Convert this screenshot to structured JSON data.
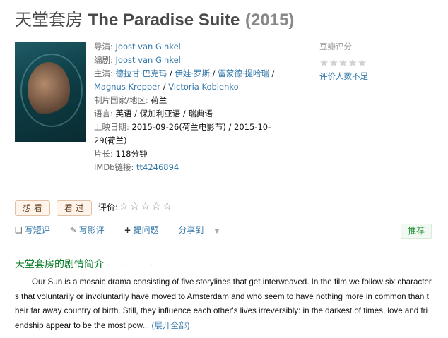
{
  "title": {
    "cn": "天堂套房",
    "en": "The Paradise Suite",
    "year": "(2015)"
  },
  "info": {
    "director_label": "导演:",
    "director": "Joost van Ginkel",
    "writer_label": "编剧:",
    "writer": "Joost van Ginkel",
    "cast_label": "主演:",
    "cast": [
      "德拉甘·巴克玛",
      "伊娃·罗斯",
      "雷蒙德·提哈瑞",
      "Magnus Krepper",
      "Victoria Koblenko"
    ],
    "country_label": "制片国家/地区:",
    "country": "荷兰",
    "language_label": "语言:",
    "language": "英语 / 保加利亚语 / 瑞典语",
    "release_label": "上映日期:",
    "release_line1": "2015-09-26(荷兰电影节) / 2015-10-",
    "release_line2": "29(荷兰)",
    "runtime_label": "片长:",
    "runtime": "118分钟",
    "imdb_label": "IMDb链接:",
    "imdb": "tt4246894"
  },
  "rating": {
    "label": "豆瓣评分",
    "stars": "★★★★★",
    "note": "评价人数不足"
  },
  "buttons": {
    "want": "想 看",
    "seen": "看 过",
    "rate_label": "评价:",
    "rate_stars": "☆☆☆☆☆"
  },
  "actions": {
    "short_review": "写短评",
    "review": "写影评",
    "question": "提问题",
    "share": "分享到",
    "recommend": "推荐"
  },
  "icons": {
    "short_review": "speech-bubble-icon",
    "review": "pencil-icon",
    "question": "plus-icon",
    "share": "dropdown-triangle-icon"
  },
  "summary": {
    "title": "天堂套房的剧情简介",
    "dots": "· · · · · ·",
    "text": "Our Sun is a mosaic drama consisting of five storylines that get interweaved. In the film we follow six characters that voluntarily or involuntarily have moved to Amsterdam and who seem to have nothing more in common than their far away country of birth. Still, they influence each other's lives irreversibly: in the darkest of times, love and friendship appear to be the most pow...",
    "more": "(展开全部)"
  },
  "colors": {
    "link": "#3377aa",
    "section_title": "#007722",
    "recommend": "#2e963d",
    "button_bg": "#fff3ea"
  }
}
